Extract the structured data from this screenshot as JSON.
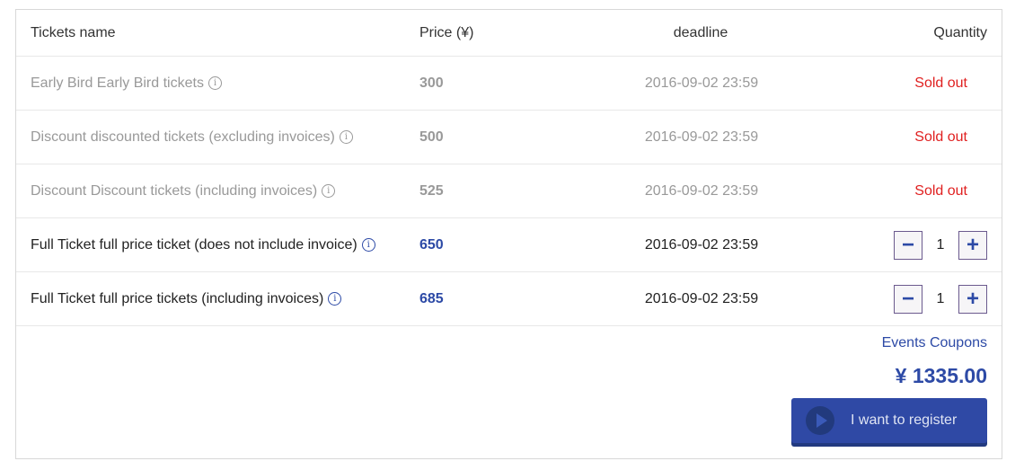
{
  "table": {
    "headers": {
      "name": "Tickets name",
      "price": "Price (¥)",
      "deadline": "deadline",
      "quantity": "Quantity"
    },
    "rows": [
      {
        "name": "Early Bird Early Bird tickets",
        "price": "300",
        "deadline": "2016-09-02 23:59",
        "status": "Sold out",
        "info_icon": "info-icon"
      },
      {
        "name": "Discount discounted tickets (excluding invoices)",
        "price": "500",
        "deadline": "2016-09-02 23:59",
        "status": "Sold out",
        "info_icon": "info-icon"
      },
      {
        "name": "Discount Discount tickets (including invoices)",
        "price": "525",
        "deadline": "2016-09-02 23:59",
        "status": "Sold out",
        "info_icon": "info-icon"
      },
      {
        "name": "Full Ticket full price ticket (does not include invoice)",
        "price": "650",
        "deadline": "2016-09-02 23:59",
        "quantity": "1",
        "info_icon": "info-icon"
      },
      {
        "name": "Full Ticket full price tickets (including invoices)",
        "price": "685",
        "deadline": "2016-09-02 23:59",
        "quantity": "1",
        "info_icon": "info-icon"
      }
    ]
  },
  "icons": {
    "info": "i",
    "minus": "−",
    "plus": "+",
    "play": "play-icon"
  },
  "footer": {
    "coupons_link": "Events Coupons",
    "total": "¥ 1335.00",
    "register_button": "I want to register"
  },
  "colors": {
    "accent": "#2d4aa6",
    "sold_out": "#e02020",
    "button_bg": "#2f49a5",
    "disabled_text": "#999999"
  }
}
